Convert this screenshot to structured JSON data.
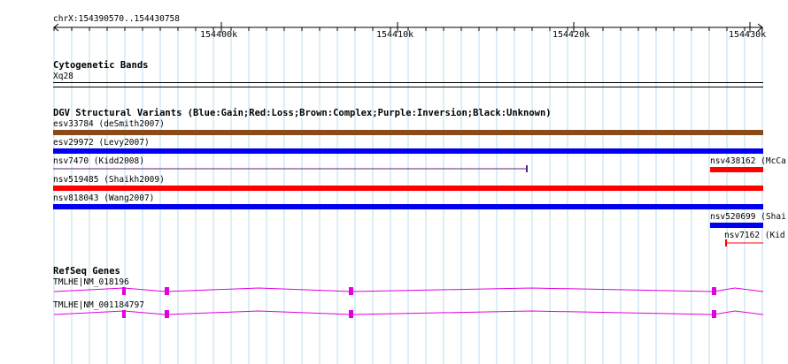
{
  "colors": {
    "grid": "#b8dcef",
    "gain": "#0000ee",
    "loss": "#ff0000",
    "complex": "#8b4a1c",
    "inversion": "#5a2378",
    "gene": "#e000e0",
    "line": "#000000"
  },
  "ruler": {
    "position_label": "chrX:154390570..154430758",
    "ticks": [
      {
        "label": "154400k"
      },
      {
        "label": "154410k"
      },
      {
        "label": "154420k"
      },
      {
        "label": "154430k"
      }
    ]
  },
  "cytoband": {
    "title": "Cytogenetic Bands",
    "band_label": "Xq28"
  },
  "dgv": {
    "title": "DGV Structural Variants (Blue:Gain;Red:Loss;Brown:Complex;Purple:Inversion;Black:Unknown)",
    "variants": [
      {
        "label": "esv33784 (deSmith2007)",
        "type": "complex"
      },
      {
        "label": "esv29972 (Levy2007)",
        "type": "gain"
      },
      {
        "label": "nsv7470 (Kidd2008)",
        "type": "inversion"
      },
      {
        "label": "nsv438162 (McCa",
        "type": "loss"
      },
      {
        "label": "nsv519485 (Shaikh2009)",
        "type": "loss"
      },
      {
        "label": "nsv818043 (Wang2007)",
        "type": "gain"
      },
      {
        "label": "nsv520699 (Shai",
        "type": "gain"
      },
      {
        "label": "nsv7162 (Kid",
        "type": "loss"
      }
    ]
  },
  "refseq": {
    "title": "RefSeq Genes",
    "transcripts": [
      {
        "label": "TMLHE|NM_018196"
      },
      {
        "label": "TMLHE|NM_001184797"
      }
    ]
  }
}
